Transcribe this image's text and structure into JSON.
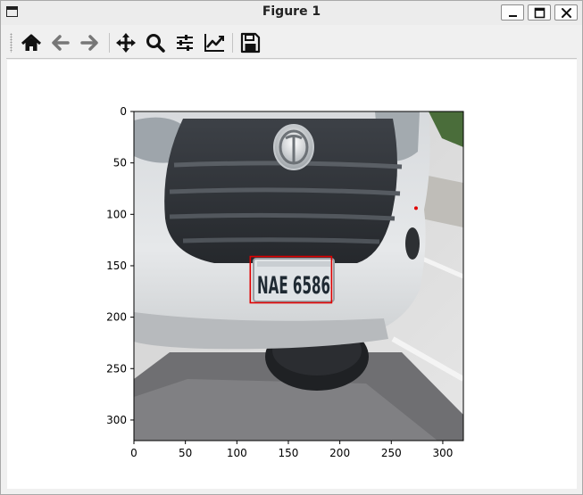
{
  "window": {
    "title": "Figure 1"
  },
  "toolbar": {
    "buttons": [
      {
        "name": "home-button",
        "icon": "home-icon"
      },
      {
        "name": "back-button",
        "icon": "arrow-left-icon"
      },
      {
        "name": "forward-button",
        "icon": "arrow-right-icon"
      },
      {
        "name": "pan-button",
        "icon": "move-icon"
      },
      {
        "name": "zoom-button",
        "icon": "magnifier-icon"
      },
      {
        "name": "configure-subplots-button",
        "icon": "sliders-icon"
      },
      {
        "name": "edit-axes-button",
        "icon": "line-chart-icon"
      },
      {
        "name": "save-button",
        "icon": "floppy-disk-icon"
      }
    ]
  },
  "plot": {
    "image_description_text": "NAE 6586",
    "x_ticks": [
      "0",
      "50",
      "100",
      "150",
      "200",
      "250",
      "300"
    ],
    "y_ticks": [
      "0",
      "50",
      "100",
      "150",
      "200",
      "250",
      "300"
    ],
    "xlim": [
      0,
      320
    ],
    "ylim": [
      320,
      0
    ],
    "bounding_box_color": "#e00000",
    "point_color": "#e00000"
  },
  "chart_data": {
    "type": "image",
    "x_ticks": [
      0,
      50,
      100,
      150,
      200,
      250,
      300
    ],
    "y_ticks": [
      0,
      50,
      100,
      150,
      200,
      250,
      300
    ],
    "xlim": [
      0,
      320
    ],
    "ylim": [
      320,
      0
    ],
    "annotations": [
      {
        "kind": "rectangle",
        "x0": 113,
        "y0": 141,
        "x1": 192,
        "y1": 186,
        "color": "#e00000"
      },
      {
        "kind": "point",
        "x": 274,
        "y": 94,
        "color": "#e00000"
      }
    ],
    "plate_text": "NAE 6586"
  }
}
